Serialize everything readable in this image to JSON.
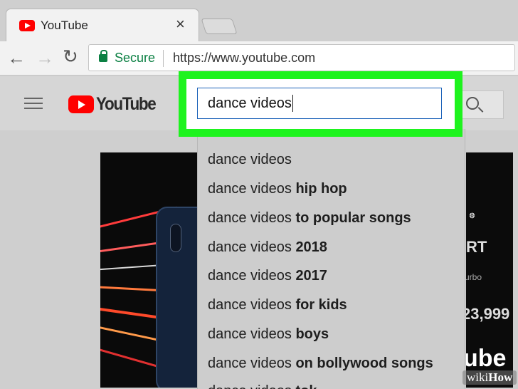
{
  "tab": {
    "title": "YouTube",
    "close": "×"
  },
  "toolbar": {
    "back": "←",
    "forward": "→",
    "reload": "↻",
    "secure_label": "Secure",
    "url": "https://www.youtube.com"
  },
  "header": {
    "logo_text": "YouTube",
    "search_value": "dance videos"
  },
  "suggestions": [
    {
      "base": "dance videos",
      "suffix": ""
    },
    {
      "base": "dance videos",
      "suffix": "hip hop"
    },
    {
      "base": "dance videos",
      "suffix": "to popular songs"
    },
    {
      "base": "dance videos",
      "suffix": "2018"
    },
    {
      "base": "dance videos",
      "suffix": "2017"
    },
    {
      "base": "dance videos",
      "suffix": "for kids"
    },
    {
      "base": "dance videos",
      "suffix": "boys"
    },
    {
      "base": "dance videos",
      "suffix": "on bollywood songs"
    },
    {
      "base": "dance videos",
      "suffix": "tok"
    }
  ],
  "thumbnail_right": {
    "line1": "RT",
    "line2": "urbo",
    "price": "23,999",
    "brand": "ube"
  },
  "watermark": {
    "wiki": "wiki",
    "how": "How"
  },
  "colors": {
    "highlight": "#1ef31e",
    "youtube_red": "#ff0000",
    "secure_green": "#0b8043",
    "input_border": "#1c62b9"
  }
}
